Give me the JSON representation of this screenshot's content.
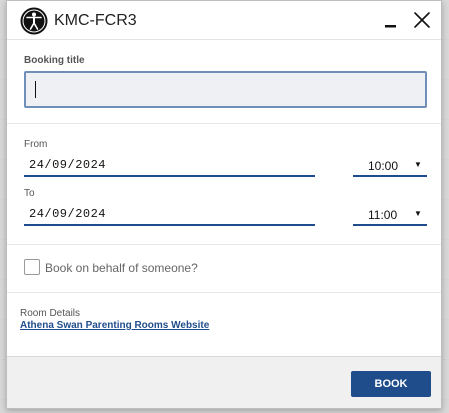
{
  "dialog": {
    "title": "KMC-FCR3"
  },
  "booking_title": {
    "label": "Booking title",
    "value": ""
  },
  "from": {
    "label": "From",
    "date": "24/09/2024",
    "time": "10:00"
  },
  "to": {
    "label": "To",
    "date": "24/09/2024",
    "time": "11:00"
  },
  "on_behalf": {
    "label": "Book on behalf of someone?",
    "checked": false
  },
  "room_details": {
    "label": "Room Details",
    "link_text": "Athena Swan Parenting Rooms Website"
  },
  "footer": {
    "book_label": "BOOK"
  },
  "icons": {
    "logo": "accessibility-person-icon",
    "minimize": "minimize-icon",
    "close": "close-icon",
    "dropdown": "chevron-down-icon"
  },
  "colors": {
    "accent": "#1f4d8c",
    "input_bg": "#eef0f4",
    "footer_bg": "#f0f0f0"
  }
}
